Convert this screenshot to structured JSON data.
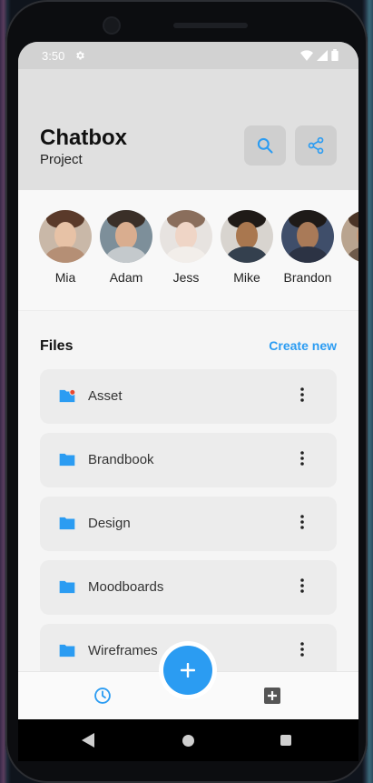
{
  "status": {
    "time": "3:50"
  },
  "header": {
    "title": "Chatbox",
    "subtitle": "Project"
  },
  "contacts": [
    {
      "name": "Mia"
    },
    {
      "name": "Adam"
    },
    {
      "name": "Jess"
    },
    {
      "name": "Mike"
    },
    {
      "name": "Brandon"
    }
  ],
  "files_section": {
    "heading": "Files",
    "create_label": "Create new",
    "items": [
      {
        "name": "Asset",
        "icon": "folder-shared-icon"
      },
      {
        "name": "Brandbook",
        "icon": "folder-icon"
      },
      {
        "name": "Design",
        "icon": "folder-icon"
      },
      {
        "name": "Moodboards",
        "icon": "folder-icon"
      },
      {
        "name": "Wireframes",
        "icon": "folder-icon"
      }
    ]
  },
  "colors": {
    "accent": "#2b9cf2",
    "header_bg": "#e0e0e0",
    "notification_dot": "#e8472f"
  }
}
